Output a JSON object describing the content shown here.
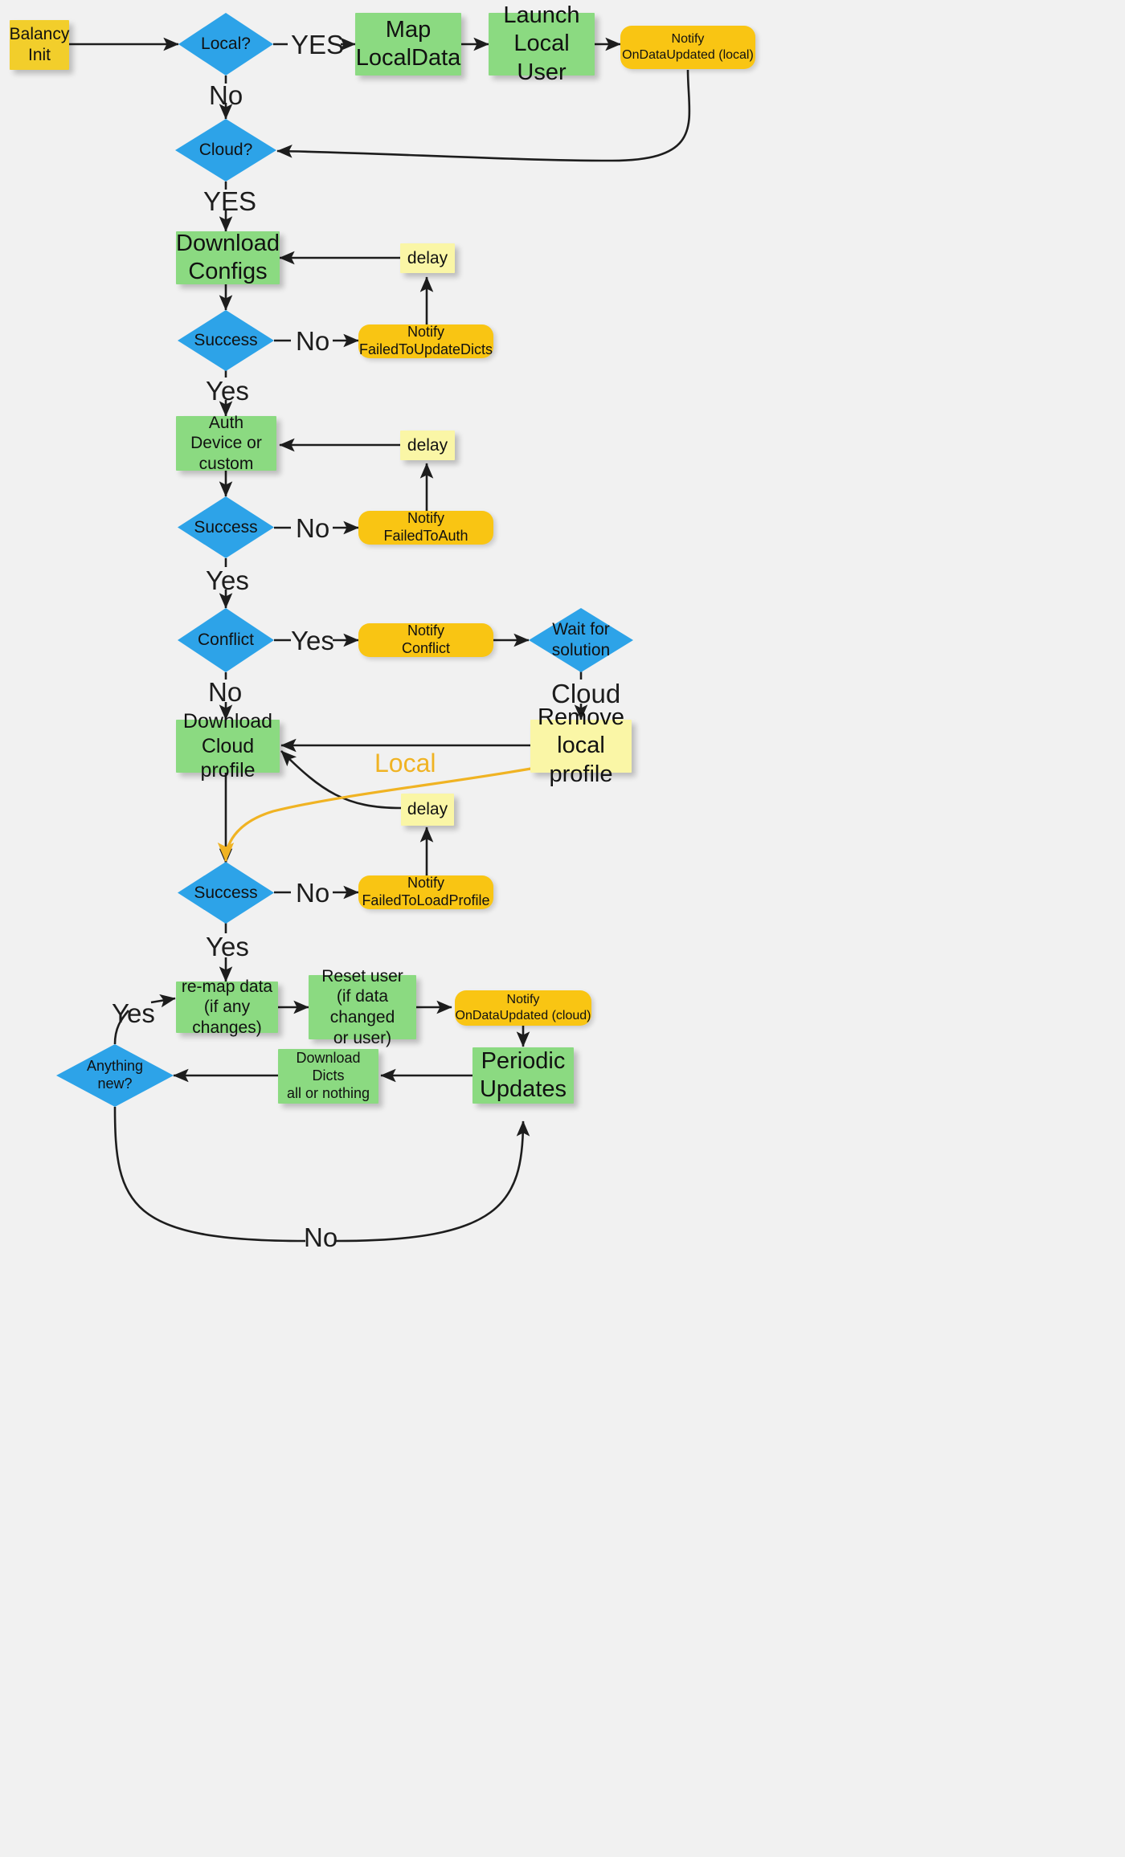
{
  "diagram": {
    "title": "Balancy Init flow",
    "background": "#f1f1f1",
    "colors": {
      "green": "#8BDA81",
      "yellow": "#F2CE2B",
      "gold": "#F9C513",
      "cream": "#FAF6A6",
      "blue": "#2DA3E8",
      "edge": "#1d1d1d",
      "local_edge": "#F0B323"
    }
  },
  "nodes": {
    "balancy_init": "Balancy\nInit",
    "local_q": "Local?",
    "map_localdata": "Map\nLocalData",
    "launch_local_user": "Launch\nLocal User",
    "notify_ondataupdated_local": "Notify\nOnDataUpdated (local)",
    "cloud_q": "Cloud?",
    "download_configs": "Download\nConfigs",
    "success_configs": "Success",
    "notify_failedtoupdatedicts": "Notify\nFailedToUpdateDicts",
    "delay_configs": "delay",
    "auth_device": "Auth\nDevice or\ncustom",
    "success_auth": "Success",
    "notify_failedtoauth": "Notify\nFailedToAuth",
    "delay_auth": "delay",
    "conflict_q": "Conflict",
    "notify_conflict": "Notify\nConflict",
    "wait_for_solution": "Wait for\nsolution",
    "remove_local_profile": "Remove\nlocal profile",
    "download_cloud_profile": "Download\nCloud profile",
    "delay_profile": "delay",
    "success_profile": "Success",
    "notify_failedtoloadprofile": "Notify\nFailedToLoadProfile",
    "remap_data": "re-map data\n(if any changes)",
    "reset_user": "Reset user\n(if data changed\nor user)",
    "notify_ondataupdated_cloud": "Notify\nOnDataUpdated (cloud)",
    "periodic_updates": "Periodic\nUpdates",
    "download_dicts": "Download Dicts\nall or nothing",
    "anything_new_q": "Anything\nnew?"
  },
  "edge_labels": {
    "local_yes": "YES",
    "local_no": "No",
    "cloud_yes": "YES",
    "configs_no": "No",
    "configs_yes": "Yes",
    "auth_no": "No",
    "auth_yes": "Yes",
    "conflict_yes": "Yes",
    "conflict_no": "No",
    "solution_cloud": "Cloud",
    "solution_local": "Local",
    "profile_no": "No",
    "profile_yes": "Yes",
    "anything_yes": "Yes",
    "anything_no": "No"
  }
}
